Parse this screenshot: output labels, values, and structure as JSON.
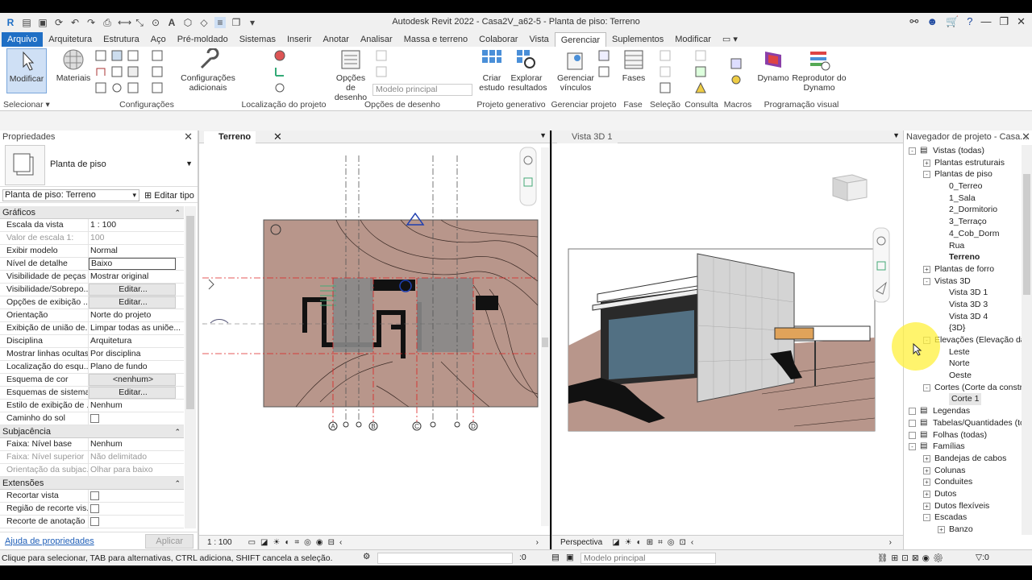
{
  "app": {
    "title": "Autodesk Revit 2022 - Casa2V_a62-5 - Planta de piso: Terreno"
  },
  "menu": {
    "items": [
      "Arquivo",
      "Arquitetura",
      "Estrutura",
      "Aço",
      "Pré-moldado",
      "Sistemas",
      "Inserir",
      "Anotar",
      "Analisar",
      "Massa e terreno",
      "Colaborar",
      "Vista",
      "Gerenciar",
      "Suplementos",
      "Modificar"
    ],
    "active": "Gerenciar"
  },
  "ribbon": {
    "modify": "Modificar",
    "materials": "Materiais",
    "config_add": "Configurações adicionais",
    "design_options": "Opções de desenho",
    "main_model": "Modelo principal",
    "create_study": "Criar estudo",
    "explore_results": "Explorar resultados",
    "manage_links": "Gerenciar vínculos",
    "phases": "Fases",
    "dynamo": "Dynamo",
    "dynamo_player": "Reprodutor do Dynamo",
    "groups": {
      "select": "Selecionar",
      "settings": "Configurações",
      "location": "Localização do projeto",
      "design_options": "Opções de desenho",
      "generative": "Projeto generativo",
      "manage_project": "Gerenciar projeto",
      "phase": "Fase",
      "selection": "Seleção",
      "inquiry": "Consulta",
      "macros": "Macros",
      "visual_programming": "Programação visual"
    }
  },
  "properties": {
    "title": "Propriedades",
    "type_name": "Planta de piso",
    "selector": "Planta de piso: Terreno",
    "edit_type": "Editar tipo",
    "sections": {
      "graphics": "Gráficos",
      "underlay": "Subjacência",
      "extents": "Extensões"
    },
    "graphics": [
      {
        "k": "Escala da vista",
        "v": "1 : 100"
      },
      {
        "k": "Valor de escala    1:",
        "v": "100",
        "dis": true
      },
      {
        "k": "Exibir modelo",
        "v": "Normal"
      },
      {
        "k": "Nível de detalhe",
        "v": "Baixo",
        "box": true
      },
      {
        "k": "Visibilidade de peças",
        "v": "Mostrar original"
      },
      {
        "k": "Visibilidade/Sobrepo...",
        "v": "Editar...",
        "btn": true
      },
      {
        "k": "Opções de exibição ...",
        "v": "Editar...",
        "btn": true
      },
      {
        "k": "Orientação",
        "v": "Norte do projeto"
      },
      {
        "k": "Exibição de união de...",
        "v": "Limpar todas as uniõe..."
      },
      {
        "k": "Disciplina",
        "v": "Arquitetura"
      },
      {
        "k": "Mostrar linhas ocultas",
        "v": "Por disciplina"
      },
      {
        "k": "Localização do esqu...",
        "v": "Plano de fundo"
      },
      {
        "k": "Esquema de cor",
        "v": "<nenhum>",
        "btn": true
      },
      {
        "k": "Esquemas de sistema...",
        "v": "Editar...",
        "btn": true
      },
      {
        "k": "Estilo de exibição de ...",
        "v": "Nenhum"
      },
      {
        "k": "Caminho do sol",
        "v": "",
        "chk": true
      }
    ],
    "underlay": [
      {
        "k": "Faixa: Nível base",
        "v": "Nenhum"
      },
      {
        "k": "Faixa: Nível superior",
        "v": "Não delimitado",
        "dis": true
      },
      {
        "k": "Orientação da subjac...",
        "v": "Olhar para baixo",
        "dis": true
      }
    ],
    "extents": [
      {
        "k": "Recortar vista",
        "v": "",
        "chk": true
      },
      {
        "k": "Região de recorte vis...",
        "v": "",
        "chk": true
      },
      {
        "k": "Recorte de anotação",
        "v": "",
        "chk": true
      }
    ],
    "help_link": "Ajuda de propriedades",
    "apply": "Aplicar"
  },
  "views": {
    "plan": {
      "tab": "Terreno",
      "scale": "1 : 100",
      "grid_labels": [
        "A",
        "B",
        "C",
        "D"
      ]
    },
    "v3d": {
      "tab": "Vista 3D 1",
      "mode": "Perspectiva"
    }
  },
  "browser": {
    "title": "Navegador de projeto - Casa...",
    "nodes": [
      {
        "label": "Vistas (todas)",
        "level": 0,
        "exp": "-"
      },
      {
        "label": "Plantas estruturais",
        "level": 1,
        "exp": "+"
      },
      {
        "label": "Plantas de piso",
        "level": 1,
        "exp": "-"
      },
      {
        "label": "0_Terreo",
        "level": 2
      },
      {
        "label": "1_Sala",
        "level": 2
      },
      {
        "label": "2_Dormitorio",
        "level": 2
      },
      {
        "label": "3_Terraço",
        "level": 2
      },
      {
        "label": "4_Cob_Dorm",
        "level": 2
      },
      {
        "label": "Rua",
        "level": 2
      },
      {
        "label": "Terreno",
        "level": 2,
        "bold": true
      },
      {
        "label": "Plantas de forro",
        "level": 1,
        "exp": "+"
      },
      {
        "label": "Vistas 3D",
        "level": 1,
        "exp": "-"
      },
      {
        "label": "Vista 3D 1",
        "level": 2
      },
      {
        "label": "Vista 3D 3",
        "level": 2
      },
      {
        "label": "Vista 3D 4",
        "level": 2
      },
      {
        "label": "{3D}",
        "level": 2
      },
      {
        "label": "Elevações (Elevação da",
        "level": 1,
        "exp": "-"
      },
      {
        "label": "Leste",
        "level": 2
      },
      {
        "label": "Norte",
        "level": 2
      },
      {
        "label": "Oeste",
        "level": 2
      },
      {
        "label": "Cortes (Corte da constru",
        "level": 1,
        "exp": "-"
      },
      {
        "label": "Corte 1",
        "level": 2,
        "sel": true
      },
      {
        "label": "Legendas",
        "level": 0,
        "exp": " "
      },
      {
        "label": "Tabelas/Quantidades (to",
        "level": 0,
        "exp": " "
      },
      {
        "label": "Folhas (todas)",
        "level": 0,
        "exp": " "
      },
      {
        "label": "Famílias",
        "level": 0,
        "exp": "-"
      },
      {
        "label": "Bandejas de cabos",
        "level": 1,
        "exp": "+"
      },
      {
        "label": "Colunas",
        "level": 1,
        "exp": "+"
      },
      {
        "label": "Conduites",
        "level": 1,
        "exp": "+"
      },
      {
        "label": "Dutos",
        "level": 1,
        "exp": "+"
      },
      {
        "label": "Dutos flexíveis",
        "level": 1,
        "exp": "+"
      },
      {
        "label": "Escadas",
        "level": 1,
        "exp": "-"
      },
      {
        "label": "Banzo",
        "level": 2,
        "exp": "+"
      }
    ]
  },
  "status": {
    "hint": "Clique para selecionar, TAB para alternativas, CTRL adiciona, SHIFT cancela a seleção.",
    "zero": ":0",
    "model": "Modelo principal",
    "filter": ":0"
  },
  "colors": {
    "accent": "#1f6fc5",
    "terrain": "#b8968b"
  }
}
